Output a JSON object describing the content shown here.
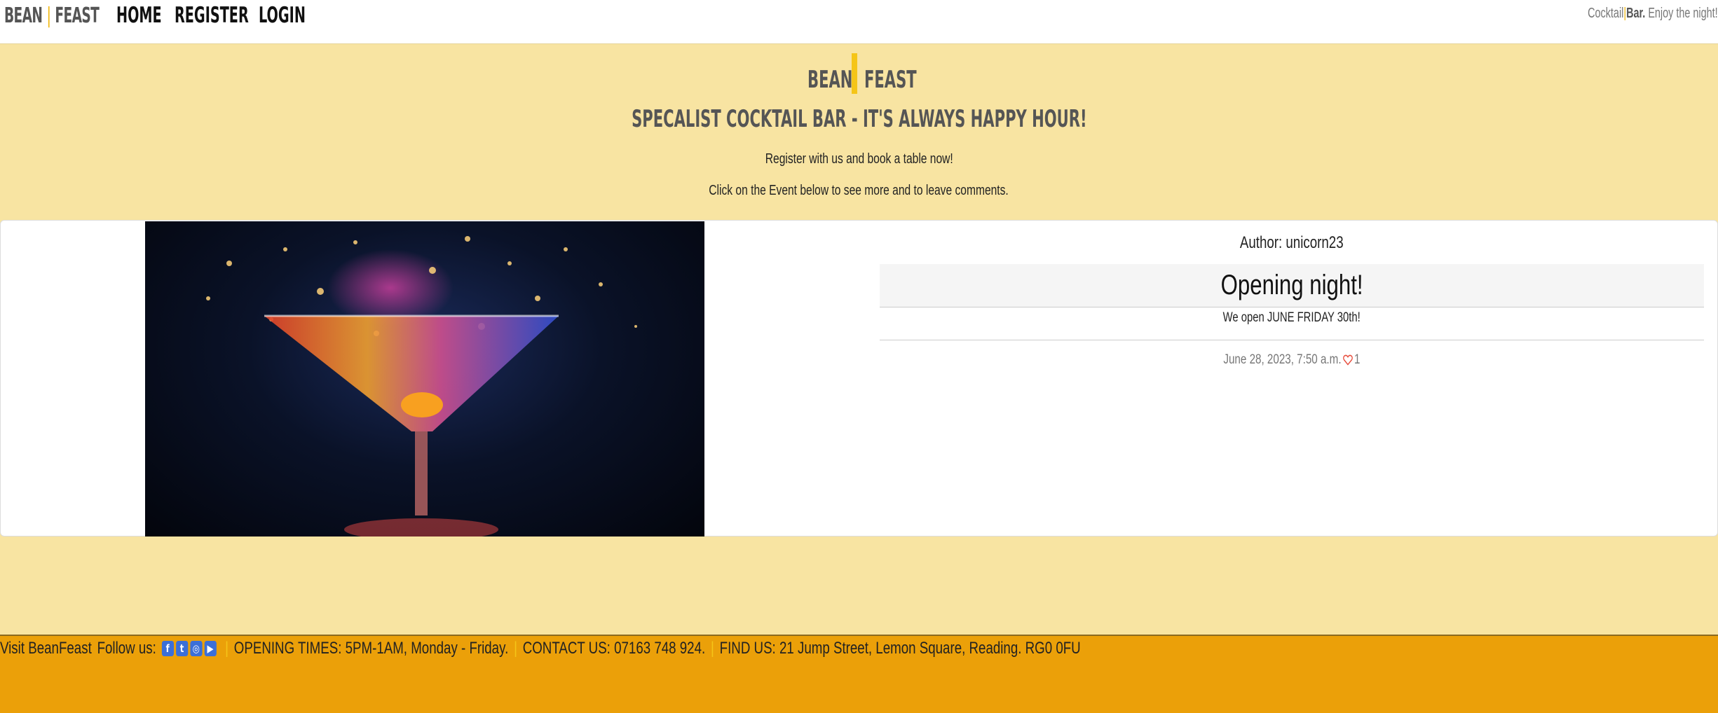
{
  "nav": {
    "brand_left": "BEAN",
    "brand_sep": "|",
    "brand_right": "FEAST",
    "links": [
      "HOME",
      "REGISTER",
      "LOGIN"
    ],
    "tagline_cocktail": "Cocktail",
    "tagline_pipe": "|",
    "tagline_bar": "Bar.",
    "tagline_rest": " Enjoy the night!"
  },
  "hero": {
    "brand_left": "BEAN",
    "brand_right": "FEAST",
    "subtitle": "SPECALIST COCKTAIL BAR - IT'S ALWAYS HAPPY HOUR!",
    "line1": "Register with us and book a table now!",
    "line2": "Click on the Event below to see more and to leave comments."
  },
  "post": {
    "author": "Author: unicorn23",
    "title": "Opening night!",
    "excerpt": "We open JUNE FRIDAY 30th!",
    "date": "June 28, 2023, 7:50 a.m.",
    "likes": "1"
  },
  "footer": {
    "visit": "Visit BeanFeast",
    "follow": "Follow us:",
    "social_icons": [
      "facebook-icon",
      "twitter-icon",
      "instagram-icon",
      "youtube-icon"
    ],
    "sep": "|",
    "opening": "OPENING TIMES: 5PM-1AM, Monday - Friday.",
    "contact": "CONTACT US: 07163 748 924.",
    "find": "FIND US: 21 Jump Street, Lemon Square, Reading. RG0 0FU"
  },
  "colors": {
    "page_bg": "#f8e4a2",
    "accent": "#f5c518",
    "footer_bg": "#eba009",
    "heart": "#e74c3c",
    "social": "#3b6fd8"
  }
}
